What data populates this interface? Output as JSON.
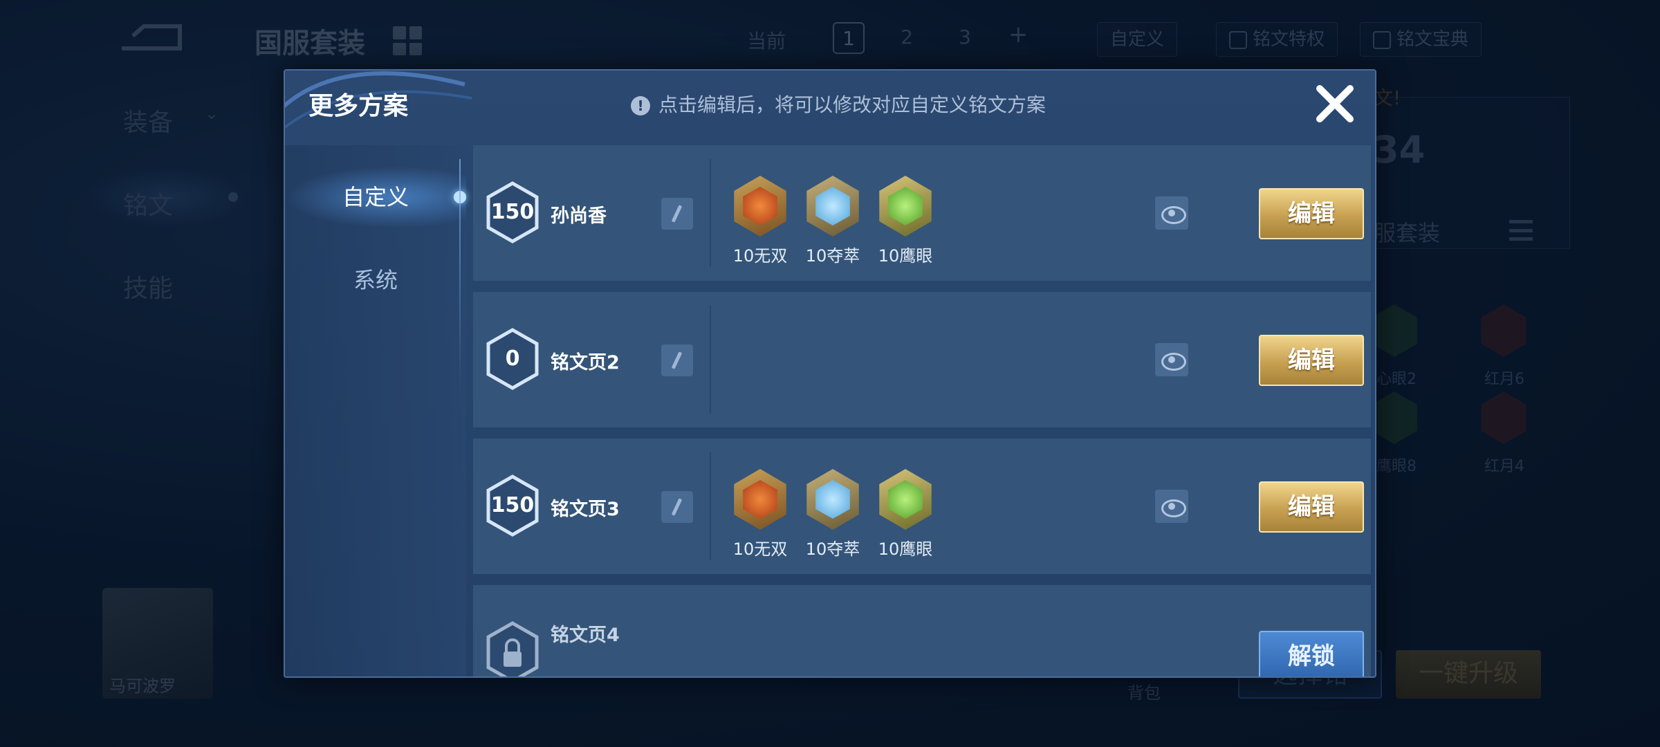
{
  "background": {
    "suit_title": "国服套装",
    "current_label": "当前",
    "page_tabs": [
      "1",
      "2",
      "3"
    ],
    "plus": "+",
    "custom_btn": "自定义",
    "privilege_btn": "铭文特权",
    "guide_btn": "铭文宝典",
    "side_nav": [
      "装备",
      "铭文",
      "技能"
    ],
    "hero_name": "马可波罗",
    "right_suit_text": "服套装",
    "big_number": "34",
    "banner_text": "文!",
    "bg_runes": [
      "心眼2",
      "红月6",
      "鹰眼8",
      "红月4"
    ],
    "bag_label": "背包",
    "select_btn": "选择铭",
    "upgrade_btn": "一键升级"
  },
  "modal": {
    "title": "更多方案",
    "hint": "点击编辑后，将可以修改对应自定义铭文方案",
    "hint_icon": "!",
    "tabs": [
      {
        "label": "自定义",
        "active": true
      },
      {
        "label": "系统",
        "active": false
      }
    ],
    "rows": [
      {
        "level": "150",
        "name": "孙尚香",
        "runes": [
          {
            "type": "red",
            "label": "10无双"
          },
          {
            "type": "blue",
            "label": "10夺萃"
          },
          {
            "type": "green",
            "label": "10鹰眼"
          }
        ],
        "action": "编辑"
      },
      {
        "level": "0",
        "name": "铭文页2",
        "runes": [],
        "action": "编辑"
      },
      {
        "level": "150",
        "name": "铭文页3",
        "runes": [
          {
            "type": "red",
            "label": "10无双"
          },
          {
            "type": "blue",
            "label": "10夺萃"
          },
          {
            "type": "green",
            "label": "10鹰眼"
          }
        ],
        "action": "编辑"
      },
      {
        "level": "",
        "name": "铭文页4",
        "locked": true,
        "runes": [],
        "action": "解锁"
      }
    ]
  },
  "colors": {
    "gold_button": "#c7a052",
    "blue_button": "#2f65ad",
    "modal_bg": "#244066",
    "row_bg": "#345579"
  },
  "icons": {
    "close": "close-icon",
    "hint": "info-icon",
    "rename": "pencil-icon",
    "preview": "eye-icon",
    "lock": "lock-icon"
  }
}
